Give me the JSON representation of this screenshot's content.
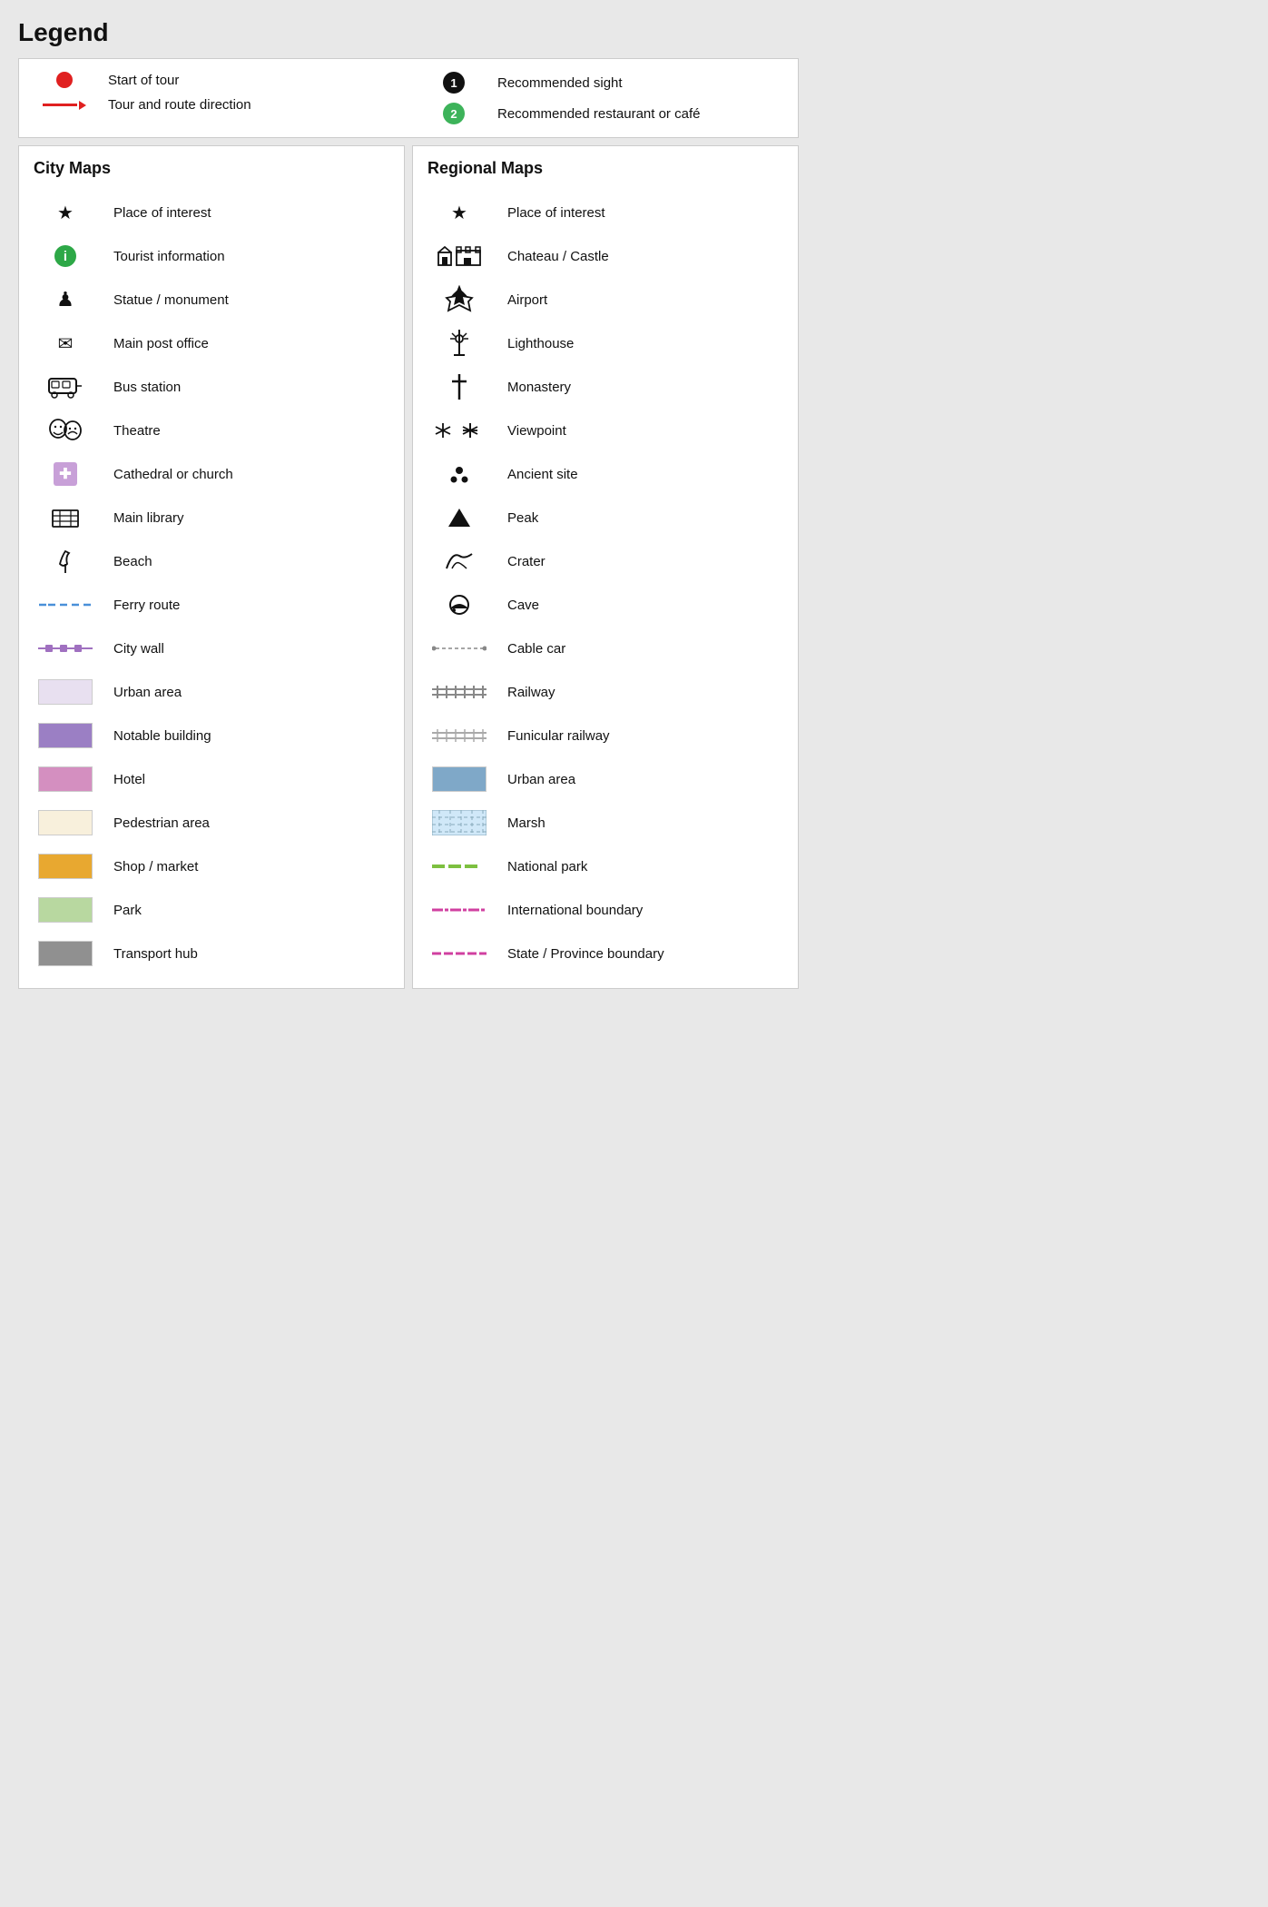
{
  "title": "Legend",
  "top": {
    "left": [
      {
        "id": "start-of-tour",
        "icon": "red-dot",
        "label": "Start of tour"
      },
      {
        "id": "tour-direction",
        "icon": "red-arrow",
        "label": "Tour and route direction"
      }
    ],
    "right": [
      {
        "id": "recommended-sight",
        "icon": "black-1",
        "label": "Recommended sight"
      },
      {
        "id": "recommended-restaurant",
        "icon": "green-2",
        "label": "Recommended restaurant or café"
      }
    ]
  },
  "city_maps": {
    "title": "City Maps",
    "items": [
      {
        "id": "place-of-interest-city",
        "icon": "star",
        "label": "Place of interest"
      },
      {
        "id": "tourist-information",
        "icon": "green-info",
        "label": "Tourist information"
      },
      {
        "id": "statue-monument",
        "icon": "chess-pawn",
        "label": "Statue / monument"
      },
      {
        "id": "main-post-office",
        "icon": "envelope",
        "label": "Main post office"
      },
      {
        "id": "bus-station",
        "icon": "bus",
        "label": "Bus station"
      },
      {
        "id": "theatre",
        "icon": "theatre",
        "label": "Theatre"
      },
      {
        "id": "cathedral-church",
        "icon": "purple-cross",
        "label": "Cathedral or church"
      },
      {
        "id": "main-library",
        "icon": "library",
        "label": "Main library"
      },
      {
        "id": "beach",
        "icon": "beach",
        "label": "Beach"
      },
      {
        "id": "ferry-route",
        "icon": "ferry-line",
        "label": "Ferry route"
      },
      {
        "id": "city-wall",
        "icon": "city-wall",
        "label": "City wall"
      },
      {
        "id": "urban-area-city",
        "icon": "box-lavender",
        "label": "Urban area"
      },
      {
        "id": "notable-building",
        "icon": "box-purple",
        "label": "Notable building"
      },
      {
        "id": "hotel",
        "icon": "box-pink",
        "label": "Hotel"
      },
      {
        "id": "pedestrian-area",
        "icon": "box-cream",
        "label": "Pedestrian area"
      },
      {
        "id": "shop-market",
        "icon": "box-orange",
        "label": "Shop / market"
      },
      {
        "id": "park",
        "icon": "box-green",
        "label": "Park"
      },
      {
        "id": "transport-hub",
        "icon": "box-gray",
        "label": "Transport hub"
      }
    ]
  },
  "regional_maps": {
    "title": "Regional Maps",
    "items": [
      {
        "id": "place-of-interest-regional",
        "icon": "star",
        "label": "Place of interest"
      },
      {
        "id": "chateau-castle",
        "icon": "castle",
        "label": "Chateau / Castle"
      },
      {
        "id": "airport",
        "icon": "airport",
        "label": "Airport"
      },
      {
        "id": "lighthouse",
        "icon": "lighthouse",
        "label": "Lighthouse"
      },
      {
        "id": "monastery",
        "icon": "cross",
        "label": "Monastery"
      },
      {
        "id": "viewpoint",
        "icon": "viewpoint",
        "label": "Viewpoint"
      },
      {
        "id": "ancient-site",
        "icon": "ancient",
        "label": "Ancient site"
      },
      {
        "id": "peak",
        "icon": "peak",
        "label": "Peak"
      },
      {
        "id": "crater",
        "icon": "crater",
        "label": "Crater"
      },
      {
        "id": "cave",
        "icon": "cave",
        "label": "Cave"
      },
      {
        "id": "cable-car",
        "icon": "cable-car",
        "label": "Cable car"
      },
      {
        "id": "railway",
        "icon": "railway",
        "label": "Railway"
      },
      {
        "id": "funicular-railway",
        "icon": "funicular",
        "label": "Funicular railway"
      },
      {
        "id": "urban-area-regional",
        "icon": "box-blue",
        "label": "Urban area"
      },
      {
        "id": "marsh",
        "icon": "box-marsh",
        "label": "Marsh"
      },
      {
        "id": "national-park",
        "icon": "national-park",
        "label": "National park"
      },
      {
        "id": "international-boundary",
        "icon": "intl-boundary",
        "label": "International boundary"
      },
      {
        "id": "state-boundary",
        "icon": "state-boundary",
        "label": "State / Province boundary"
      }
    ]
  }
}
